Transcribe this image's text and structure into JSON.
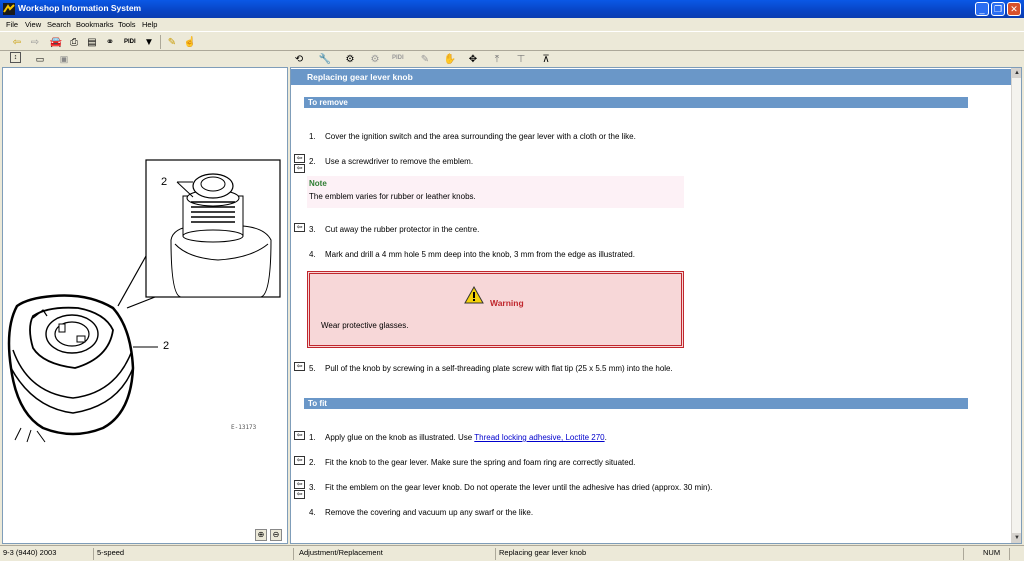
{
  "window": {
    "title": "Workshop Information System"
  },
  "menu": [
    "File",
    "View",
    "Search",
    "Bookmarks",
    "Tools",
    "Help"
  ],
  "toolbar": {
    "pidi_label": "PIDI",
    "pidi_label_2": "PIDI"
  },
  "document": {
    "header": "Replacing gear lever knob",
    "remove_section": "To remove",
    "fit_section": "To fit",
    "remove_steps": [
      {
        "num": "1.",
        "text": "Cover the ignition switch and the area surrounding the gear lever with a cloth or the like."
      },
      {
        "num": "2.",
        "text": "Use a screwdriver to remove the emblem."
      },
      {
        "num": "3.",
        "text": "Cut away the rubber protector in the centre."
      },
      {
        "num": "4.",
        "text": "Mark and drill a 4 mm hole 5 mm deep into the knob, 3 mm from the edge as illustrated."
      },
      {
        "num": "5.",
        "text": "Pull of the knob by screwing in a self-threading plate screw with flat tip (25 x 5.5 mm) into the hole."
      }
    ],
    "note": {
      "title": "Note",
      "text": "The emblem varies for rubber or leather knobs."
    },
    "warning": {
      "title": "Warning",
      "text": "Wear protective glasses."
    },
    "fit_steps": [
      {
        "num": "1.",
        "text_before": "Apply glue on the knob as illustrated. Use ",
        "link": "Thread locking adhesive, Loctite 270",
        "text_after": "."
      },
      {
        "num": "2.",
        "text": "Fit the knob to the gear lever. Make sure the spring and foam ring are correctly situated."
      },
      {
        "num": "3.",
        "text": "Fit the emblem on the gear lever knob. Do not operate the lever until the adhesive has dried (approx. 30 min)."
      },
      {
        "num": "4.",
        "text": "Remove the covering and vacuum up any swarf or the like."
      }
    ]
  },
  "illustration": {
    "callout_top": "2",
    "callout_side": "2",
    "code": "E-13173"
  },
  "statusbar": {
    "vehicle": "9-3 (9440) 2003",
    "gearbox": "5-speed",
    "category": "Adjustment/Replacement",
    "topic": "Replacing gear lever knob",
    "num": "NUM"
  }
}
